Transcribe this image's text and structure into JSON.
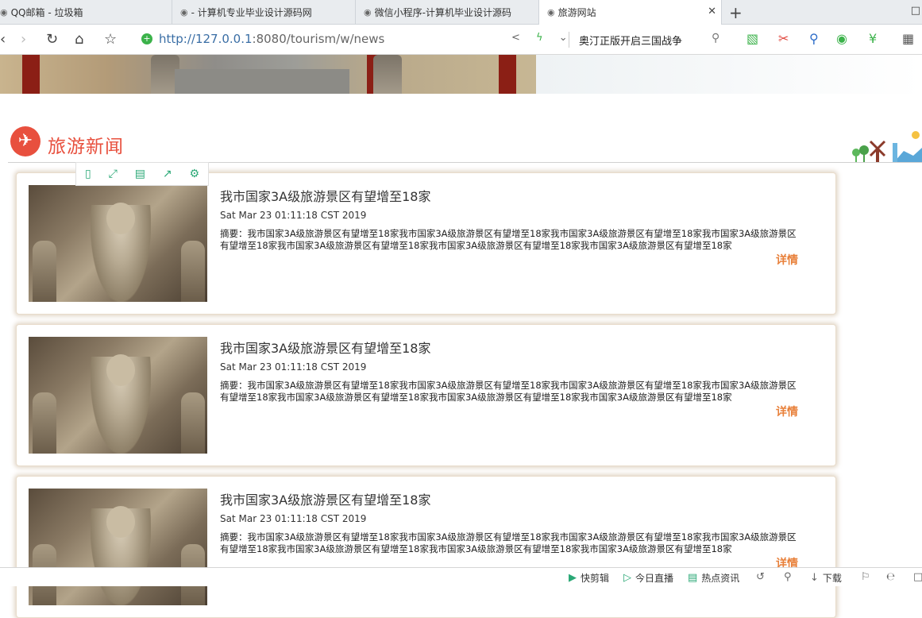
{
  "browser": {
    "tabs": [
      {
        "title": "QQ邮箱 - 垃圾箱",
        "active": false
      },
      {
        "title": "- 计算机专业毕业设计源码网",
        "active": false
      },
      {
        "title": "微信小程序-计算机毕业设计源码",
        "active": false
      },
      {
        "title": "旅游网站",
        "active": true
      }
    ],
    "url_host": "http://127.0.0.1",
    "url_path": ":8080/tourism/w/news",
    "hot_search": "奥汀正版开启三国战争"
  },
  "section": {
    "title": "旅游新闻"
  },
  "news": [
    {
      "title": "我市国家3A级旅游景区有望增至18家",
      "date": "Sat Mar 23 01:11:18 CST 2019",
      "summary": "摘要：我市国家3A级旅游景区有望增至18家我市国家3A级旅游景区有望增至18家我市国家3A级旅游景区有望增至18家我市国家3A级旅游景区有望增至18家我市国家3A级旅游景区有望增至18家我市国家3A级旅游景区有望增至18家我市国家3A级旅游景区有望增至18家",
      "more": "详情"
    },
    {
      "title": "我市国家3A级旅游景区有望增至18家",
      "date": "Sat Mar 23 01:11:18 CST 2019",
      "summary": "摘要：我市国家3A级旅游景区有望增至18家我市国家3A级旅游景区有望增至18家我市国家3A级旅游景区有望增至18家我市国家3A级旅游景区有望增至18家我市国家3A级旅游景区有望增至18家我市国家3A级旅游景区有望增至18家我市国家3A级旅游景区有望增至18家",
      "more": "详情"
    },
    {
      "title": "我市国家3A级旅游景区有望增至18家",
      "date": "Sat Mar 23 01:11:18 CST 2019",
      "summary": "摘要：我市国家3A级旅游景区有望增至18家我市国家3A级旅游景区有望增至18家我市国家3A级旅游景区有望增至18家我市国家3A级旅游景区有望增至18家我市国家3A级旅游景区有望增至18家我市国家3A级旅游景区有望增至18家我市国家3A级旅游景区有望增至18家",
      "more": "详情"
    }
  ],
  "status_bar": {
    "items": [
      "快剪辑",
      "今日直播",
      "热点资讯",
      "下载"
    ]
  },
  "colors": {
    "accent": "#e8503e",
    "more_link": "#e8803a",
    "card_glow": "#bea582"
  },
  "icons": {
    "float_toolbar": [
      "phone-icon",
      "fullscreen-icon",
      "save-icon",
      "share-icon",
      "settings-icon"
    ]
  }
}
